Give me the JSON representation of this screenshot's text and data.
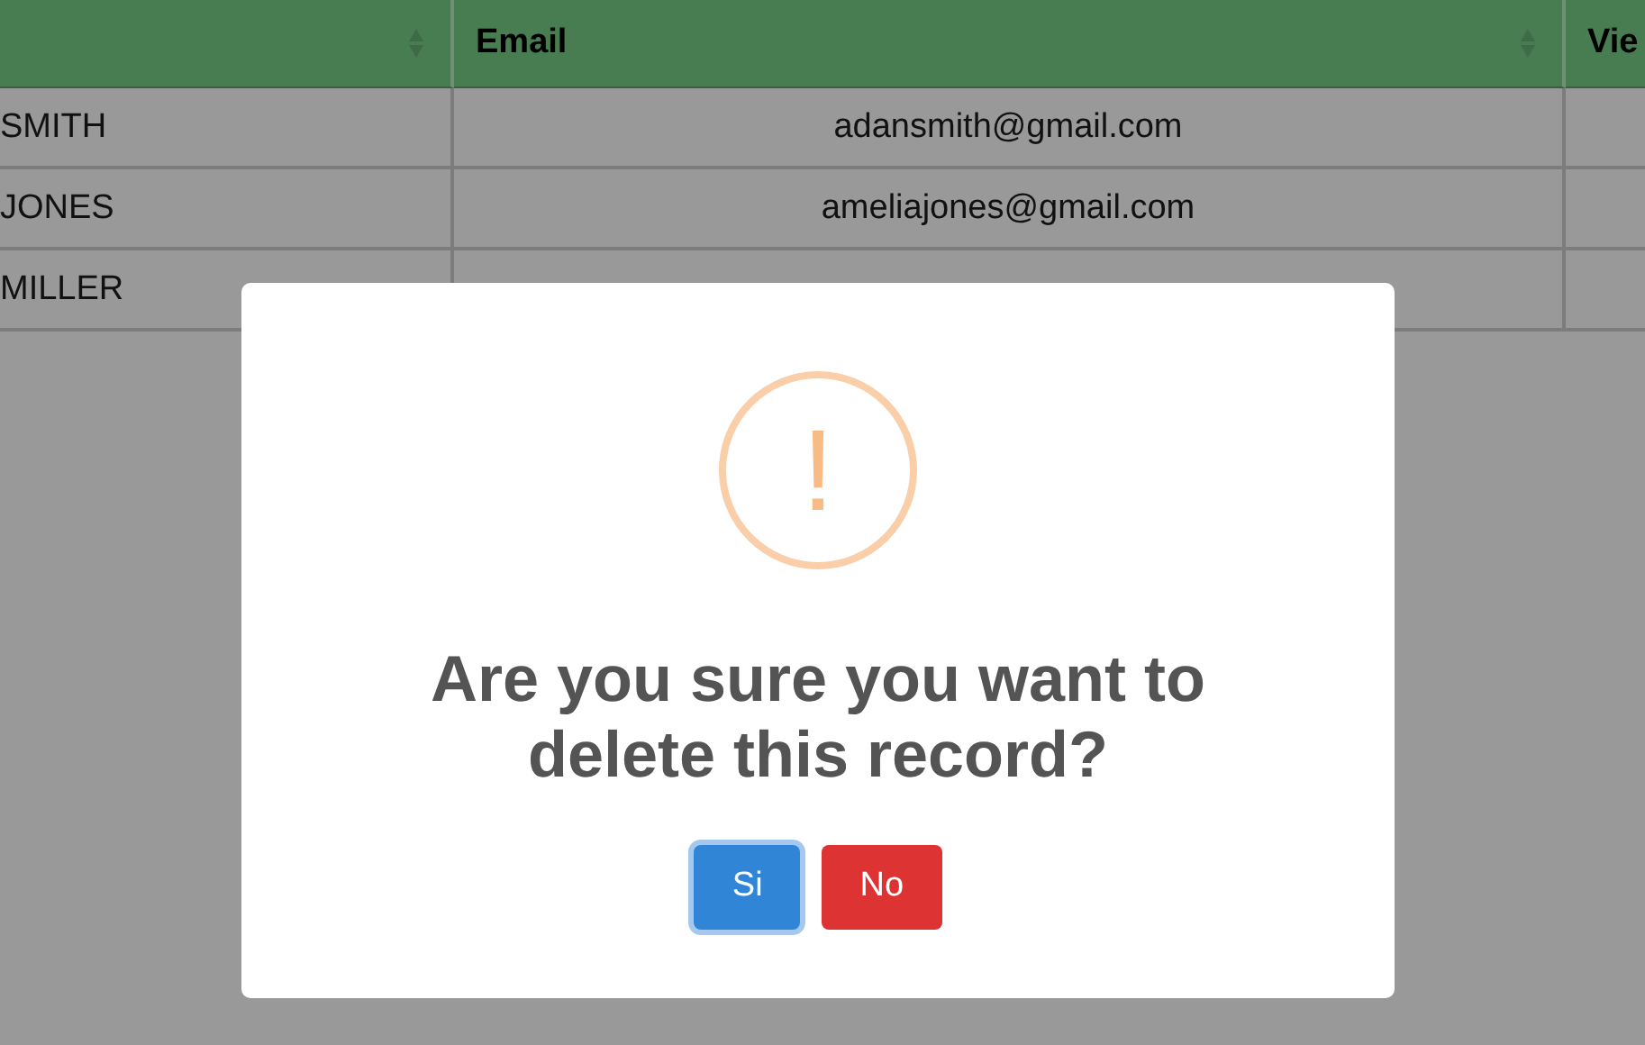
{
  "table": {
    "columns": [
      {
        "sortable": true
      },
      {
        "label": "Email",
        "sortable": true
      },
      {
        "label": "Vie",
        "sortable": false
      }
    ],
    "rows": [
      {
        "cells": [
          "SMITH",
          "adansmith@gmail.com"
        ]
      },
      {
        "cells": [
          "JONES",
          "ameliajones@gmail.com"
        ]
      },
      {
        "cells": [
          "MILLER"
        ]
      }
    ]
  },
  "dialog": {
    "icon": "!",
    "title": "Are you sure you want to delete this record?",
    "buttons": [
      {
        "label": "Si",
        "kind": "confirm",
        "focused": true
      },
      {
        "label": "No",
        "kind": "cancel",
        "focused": false
      }
    ]
  }
}
